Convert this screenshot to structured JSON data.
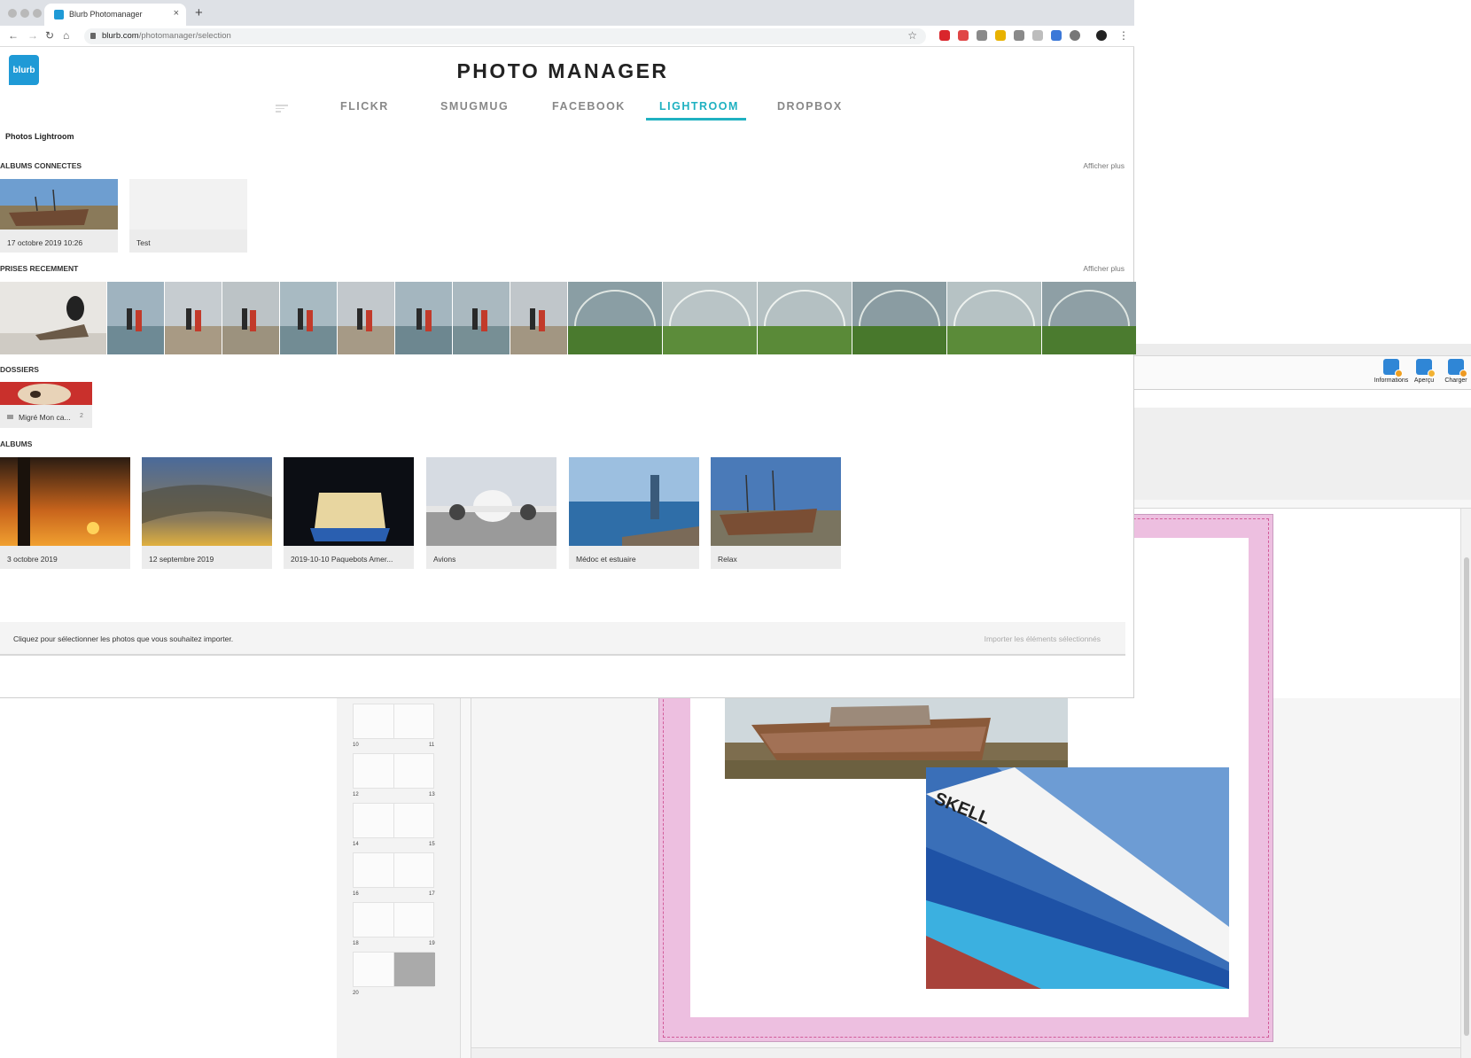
{
  "editor": {
    "toolbar": [
      {
        "label": "Informations",
        "icon": "info-icon"
      },
      {
        "label": "Aperçu",
        "icon": "preview-icon"
      },
      {
        "label": "Charger",
        "icon": "upload-icon"
      }
    ],
    "pages": [
      "10",
      "11",
      "12",
      "13",
      "14",
      "15",
      "16",
      "17",
      "18",
      "19",
      "20"
    ]
  },
  "browser": {
    "tab_title": "Blurb Photomanager",
    "tab_close": "×",
    "new_tab": "+",
    "url_host": "blurb.com",
    "url_path": "/photomanager/selection"
  },
  "page": {
    "logo": "blurb",
    "title": "PHOTO MANAGER",
    "sources": [
      "FLICKR",
      "SMUGMUG",
      "FACEBOOK",
      "LIGHTROOM",
      "DROPBOX"
    ],
    "active_source": "LIGHTROOM",
    "breadcrumb": "Photos Lightroom",
    "connected": {
      "heading": "ALBUMS CONNECTES",
      "more": "Afficher plus",
      "items": [
        "17 octobre 2019 10:26",
        "Test"
      ]
    },
    "recent": {
      "heading": "PRISES RECEMMENT",
      "more": "Afficher plus"
    },
    "folders": {
      "heading": "DOSSIERS",
      "items": [
        {
          "name": "Migré Mon ca...",
          "count": "2"
        }
      ]
    },
    "albums": {
      "heading": "ALBUMS",
      "items": [
        "3 octobre 2019",
        "12 septembre 2019",
        "2019-10-10 Paquebots Amer...",
        "Avions",
        "Médoc et estuaire",
        "Relax"
      ]
    },
    "footer": {
      "hint": "Cliquez pour sélectionner les photos que vous souhaitez importer.",
      "import": "Importer les éléments sélectionnés"
    }
  }
}
